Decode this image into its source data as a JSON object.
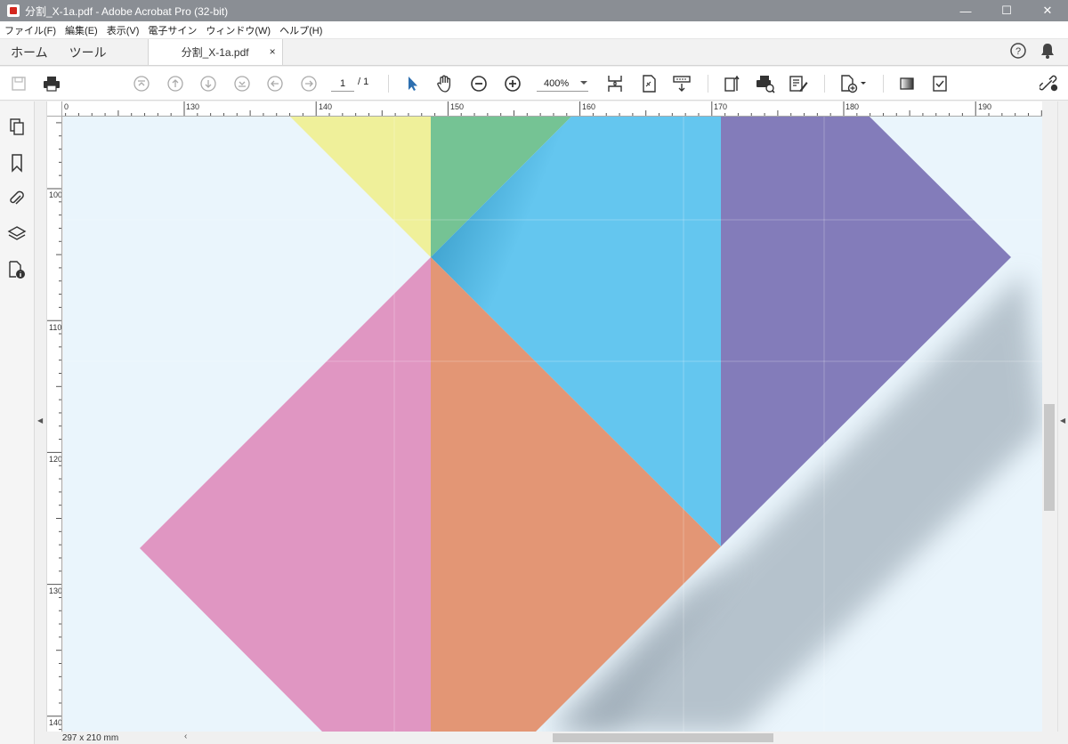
{
  "window": {
    "title": "分割_X-1a.pdf - Adobe Acrobat Pro (32-bit)",
    "minimize": "—",
    "maximize": "☐",
    "close": "✕"
  },
  "menu": [
    "ファイル(F)",
    "編集(E)",
    "表示(V)",
    "電子サイン",
    "ウィンドウ(W)",
    "ヘルプ(H)"
  ],
  "tabs": {
    "home": "ホーム",
    "tools": "ツール",
    "document": "分割_X-1a.pdf",
    "close": "×"
  },
  "toolbar": {
    "page_current": "1",
    "page_total": "/ 1",
    "zoom": "400%"
  },
  "ruler": {
    "top_labels": [
      "0",
      "130",
      "140",
      "150",
      "160",
      "170",
      "180",
      "190"
    ],
    "left_labels": [
      "100",
      "110",
      "120",
      "130",
      "140"
    ]
  },
  "status": {
    "page_size": "297 x 210 mm"
  },
  "artwork": {
    "colors": {
      "yellow": "#eff09a",
      "green": "#75c394",
      "blue": "#64c6ef",
      "purple": "#837cba",
      "pink": "#e096c2",
      "orange": "#e39675",
      "background": "#eaf5fc"
    }
  }
}
